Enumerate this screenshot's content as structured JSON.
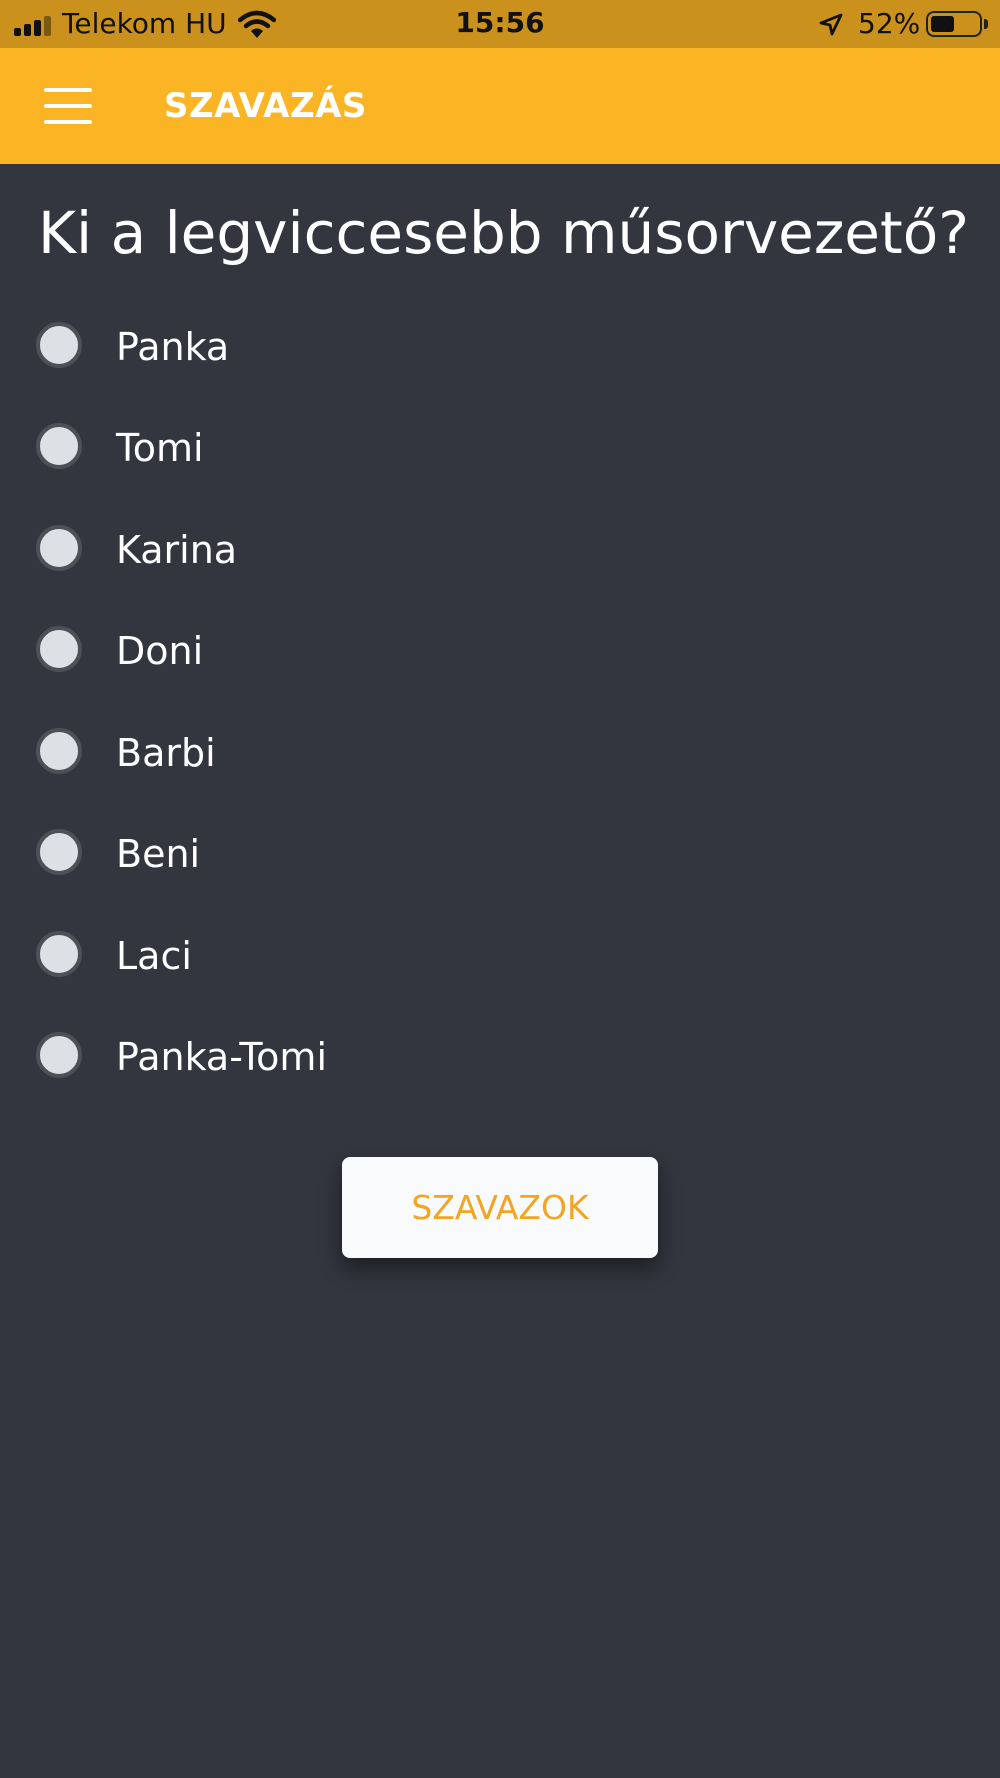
{
  "status_bar": {
    "carrier": "Telekom HU",
    "time": "15:56",
    "battery_percent": "52%",
    "battery_level": 0.52,
    "icons": [
      "signal-icon",
      "wifi-icon",
      "location-arrow-icon",
      "battery-icon"
    ]
  },
  "app_bar": {
    "title": "SZAVAZÁS",
    "background": "#fbb524",
    "menu_icon": "hamburger-menu-icon"
  },
  "poll": {
    "question": "Ki a legviccesebb műsorvezető?",
    "options": [
      {
        "label": "Panka"
      },
      {
        "label": "Tomi"
      },
      {
        "label": "Karina"
      },
      {
        "label": "Doni"
      },
      {
        "label": "Barbi"
      },
      {
        "label": "Beni"
      },
      {
        "label": "Laci"
      },
      {
        "label": "Panka-Tomi"
      }
    ],
    "submit_label": "SZAVAZOK"
  },
  "colors": {
    "background": "#33353f",
    "accent": "#f2a425",
    "status_bar": "#cb911d"
  }
}
